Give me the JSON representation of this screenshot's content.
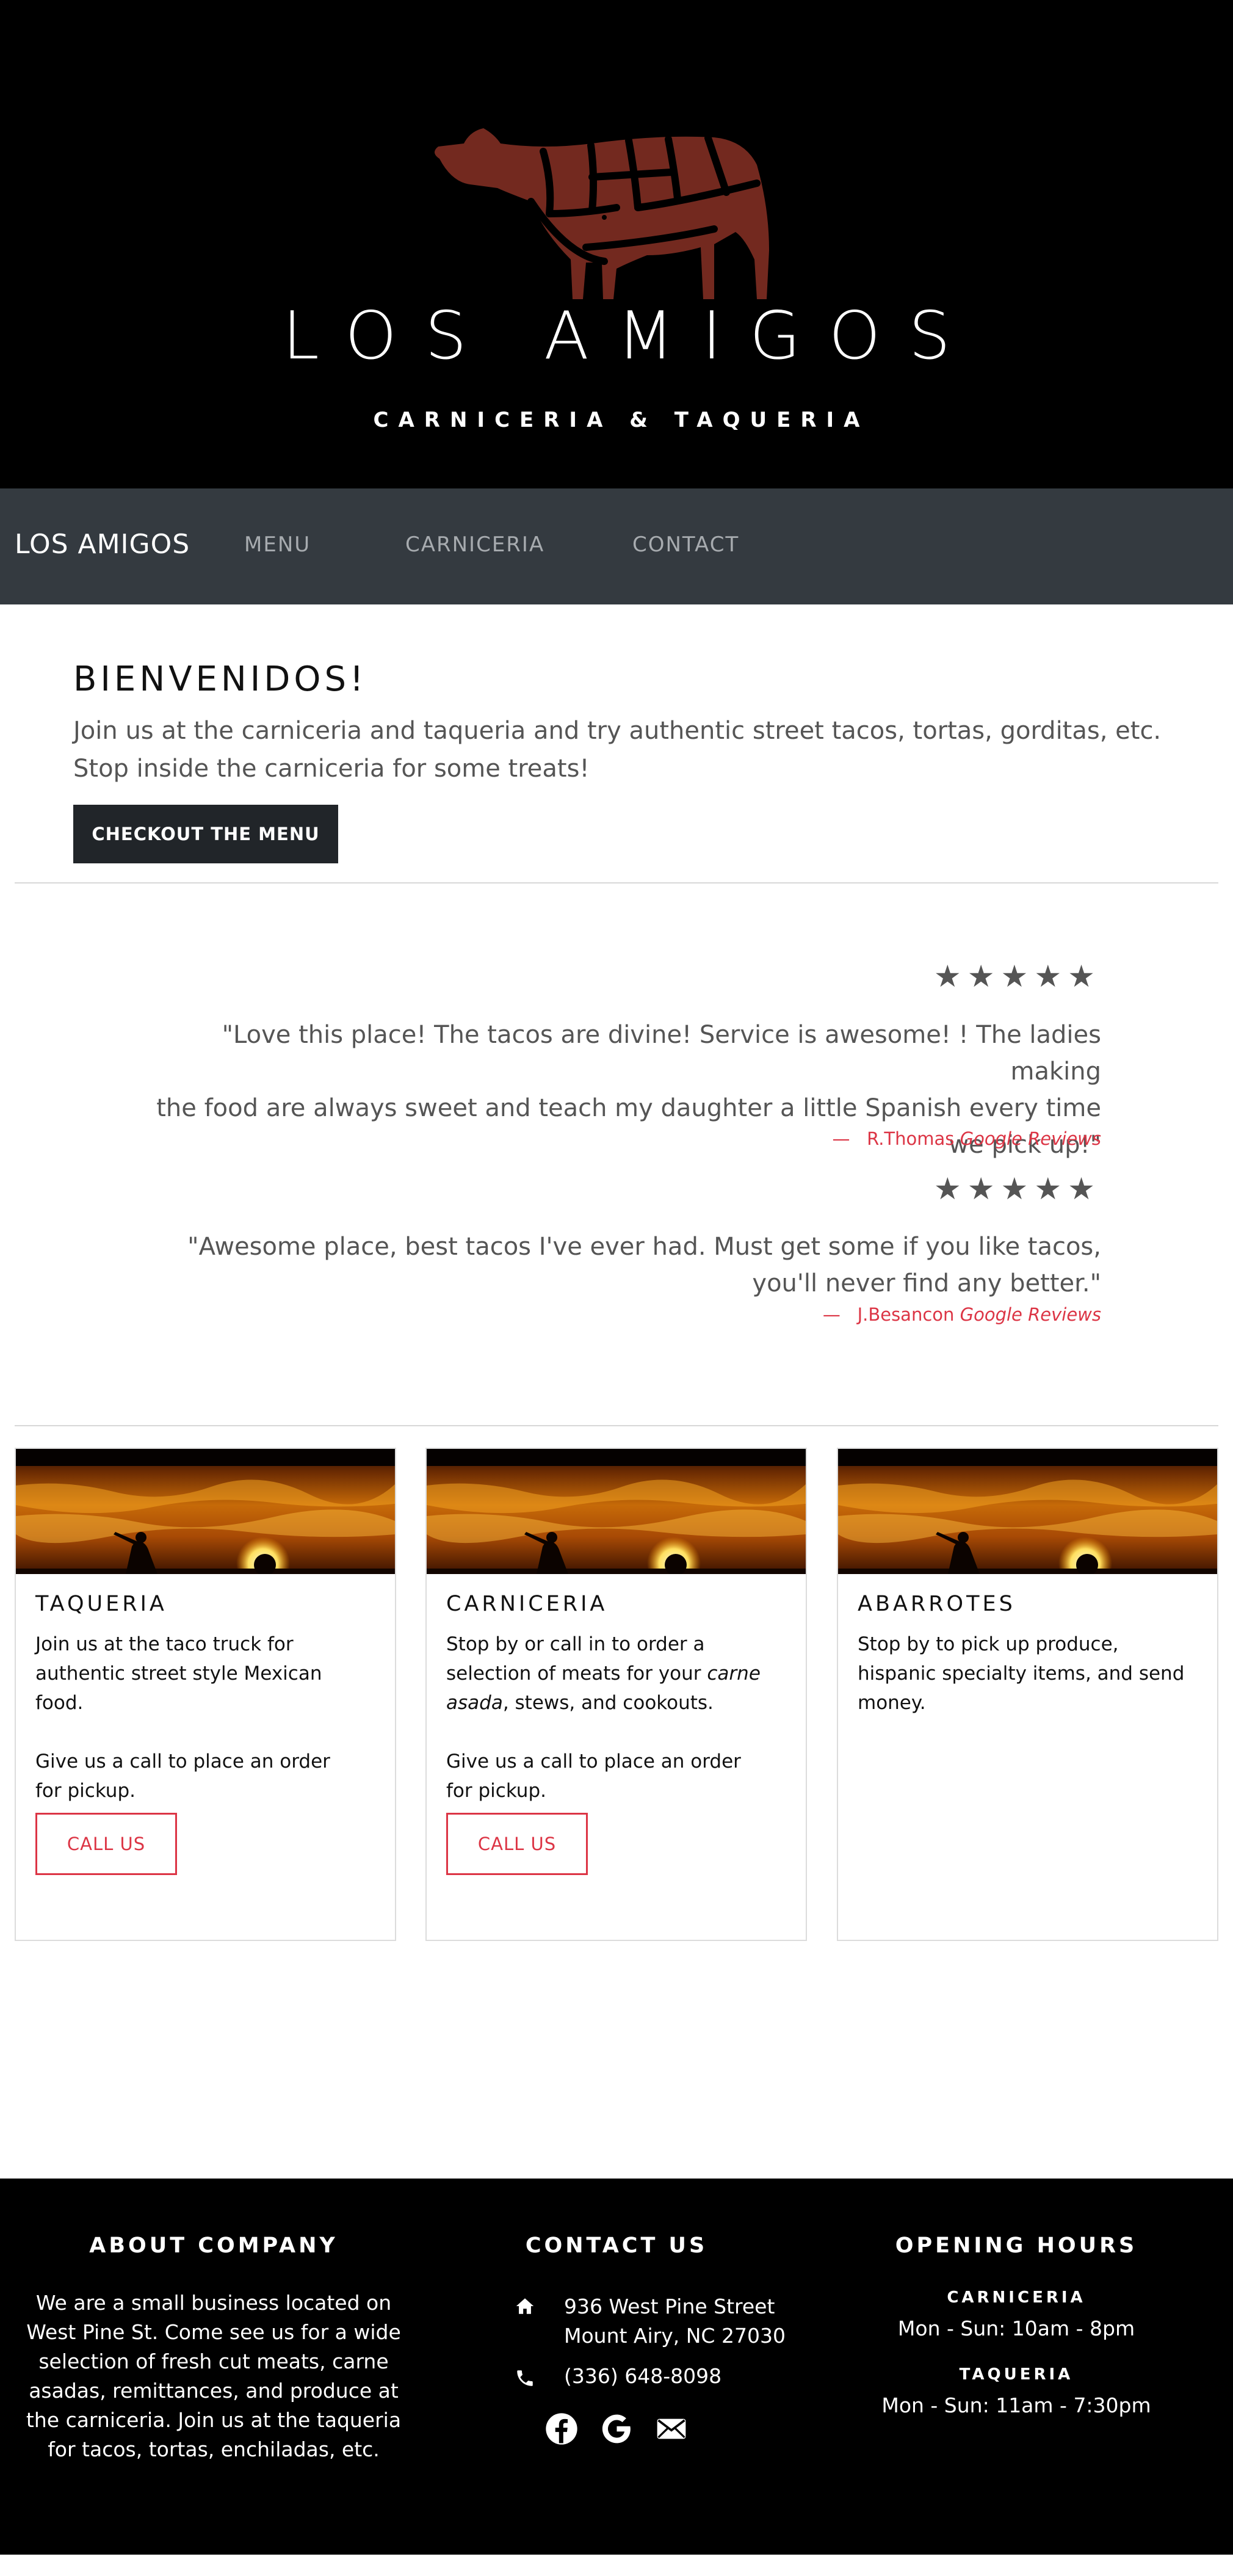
{
  "hero": {
    "title": "LOS AMIGOS",
    "subtitle": "CARNICERIA & TAQUERIA",
    "logo_icon": "cow-butcher-cuts-icon"
  },
  "navbar": {
    "brand": "LOS AMIGOS",
    "links": [
      "MENU",
      "CARNICERIA",
      "CONTACT"
    ]
  },
  "welcome": {
    "heading": "BIENVENIDOS!",
    "text_line1": "Join us at the carniceria and taqueria and try authentic street tacos, tortas, gorditas, etc.",
    "text_line2": "Stop inside the carniceria for some treats!",
    "button": "CHECKOUT THE MENU"
  },
  "reviews": [
    {
      "stars": "★★★★★",
      "rating": 5,
      "lines": [
        "\"Love this place! The tacos are divine! Service is awesome! ! The ladies making",
        "the food are always sweet and teach my daughter a little Spanish every time",
        "we pick up!\""
      ],
      "dash": "—",
      "author": "R.Thomas",
      "source": "Google Reviews"
    },
    {
      "stars": "★★★★★",
      "rating": 5,
      "lines": [
        "\"Awesome place, best tacos I've ever had. Must get some if you like tacos,",
        "you'll never find any better.\""
      ],
      "dash": "—",
      "author": "J.Besancon",
      "source": "Google Reviews"
    }
  ],
  "cards": [
    {
      "title": "TAQUERIA",
      "text_lines": [
        "Join us at the taco truck for",
        "authentic street style Mexican",
        "food."
      ],
      "text2_lines": [
        "Give us a call to place an order",
        "for pickup."
      ],
      "button": "CALL US"
    },
    {
      "title": "CARNICERIA",
      "text_l1": "Stop by or call in to order a",
      "text_l2a": "selection of meats for your ",
      "text_l2b": "carne",
      "text_l3a": "asada",
      "text_l3b": ", stews, and cookouts.",
      "text2_lines": [
        "Give us a call to place an order",
        "for pickup."
      ],
      "button": "CALL US"
    },
    {
      "title": "ABARROTES",
      "text_lines": [
        "Stop by to pick up produce,",
        "hispanic specialty items, and send",
        "money."
      ]
    }
  ],
  "footer": {
    "about": {
      "heading": "ABOUT COMPANY",
      "lines": [
        "We are a small business located on",
        "West Pine St. Come see us for a wide",
        "selection of fresh cut meats, carne",
        "asadas, remittances, and produce at",
        "the carniceria. Join us at the taqueria",
        "for tacos, tortas, enchiladas, etc."
      ]
    },
    "contact": {
      "heading": "CONTACT US",
      "address1": "936 West Pine Street",
      "address2": "Mount Airy, NC 27030",
      "phone": "(336) 648-8098",
      "social_icons": [
        "facebook-icon",
        "google-icon",
        "email-icon"
      ]
    },
    "hours": {
      "heading": "OPENING HOURS",
      "carniceria_label": "CARNICERIA",
      "carniceria_hours": "Mon - Sun: 10am - 8pm",
      "taqueria_label": "TAQUERIA",
      "taqueria_hours": "Mon - Sun: 11am - 7:30pm"
    }
  },
  "colors": {
    "hero_bg": "#000000",
    "nav_bg": "#343a40",
    "accent_red": "#dc3545",
    "button_dark": "#212529",
    "cow_fill": "#7a2e24"
  }
}
